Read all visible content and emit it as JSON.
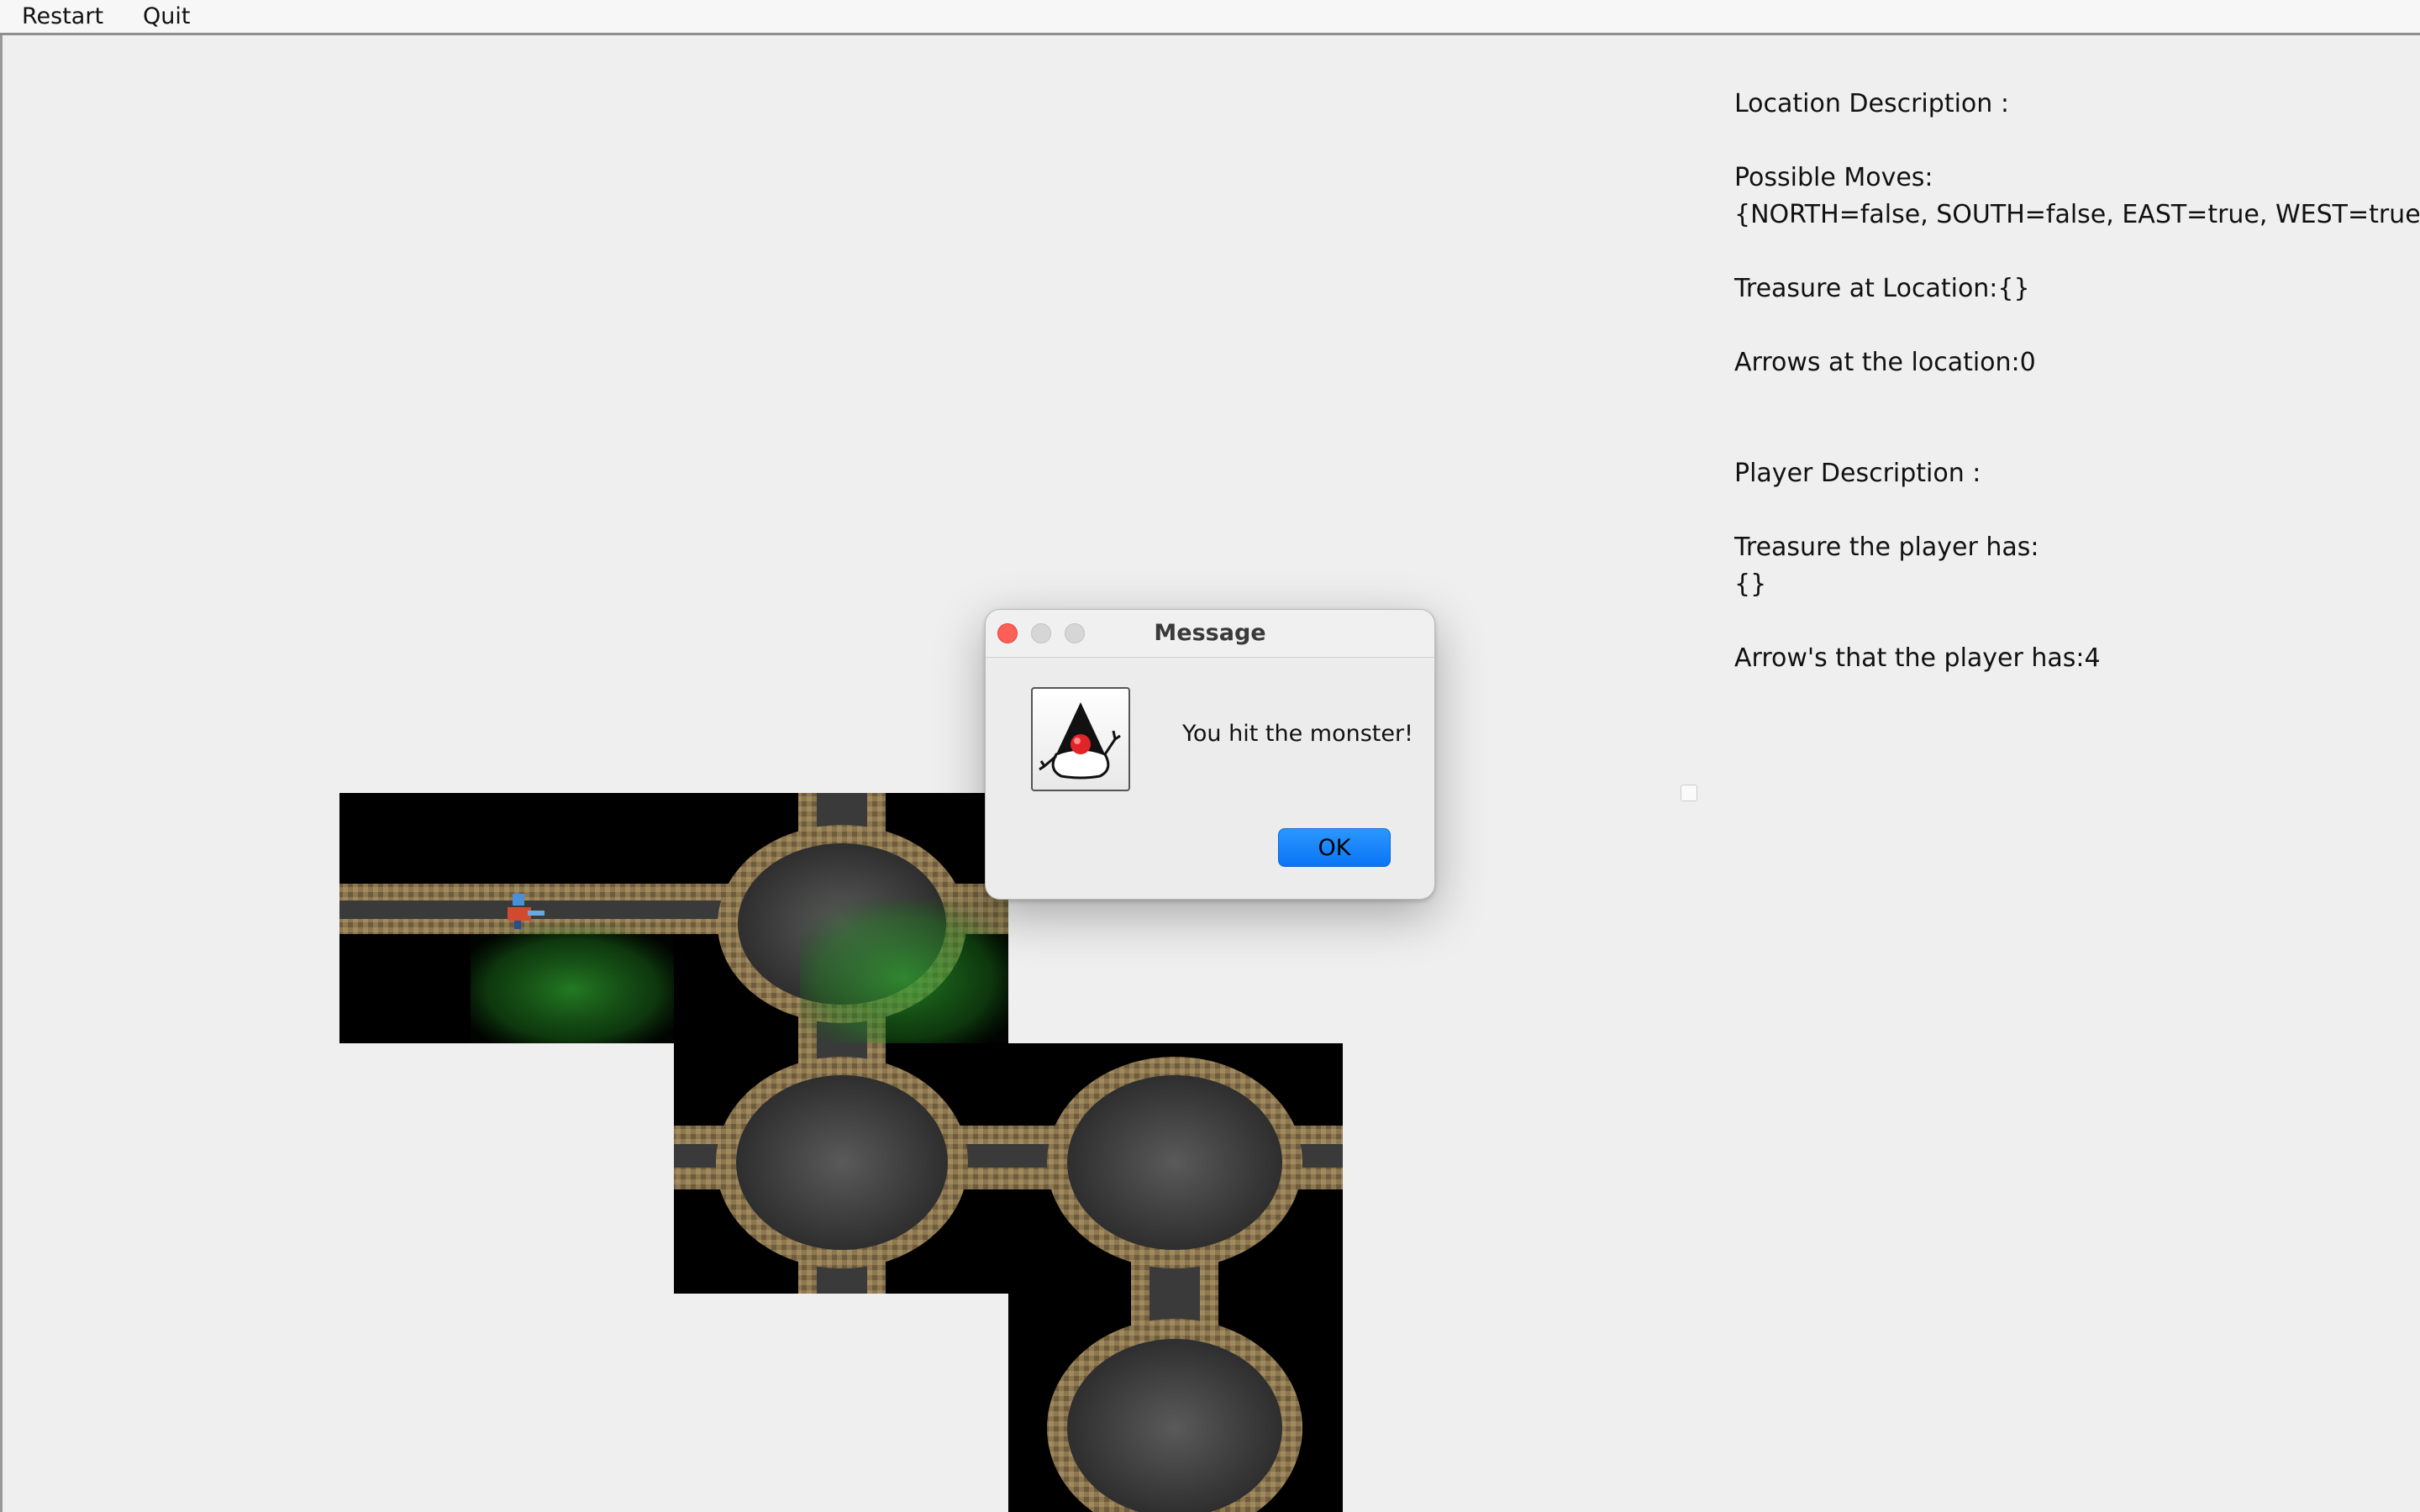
{
  "menu": {
    "restart_label": "Restart",
    "quit_label": "Quit"
  },
  "location": {
    "heading": "Location Description :",
    "moves_label": "Possible Moves:",
    "moves_value": "{NORTH=false, SOUTH=false, EAST=true, WEST=true}",
    "treasure_label": "Treasure at Location:{}",
    "arrows_label": "Arrows at the location:0"
  },
  "player": {
    "heading": "Player Description :",
    "treasure_label": "Treasure the player has:",
    "treasure_value": "{}",
    "arrows_label": "Arrow's that the player has:4"
  },
  "dialog": {
    "title": "Message",
    "message": "You hit the monster!",
    "ok_label": "OK",
    "icon": "java-duke-icon"
  },
  "map": {
    "tiles": [
      "corridor-east-west",
      "junction-east-west-south",
      "junction-north-south-east-west",
      "junction-west-south",
      "junction-north-only"
    ],
    "player_icon": "player-sprite",
    "smell_indicator": "green-stench-overlay"
  },
  "colors": {
    "background": "#efefef",
    "ok_button": "#0a7cff",
    "close_button": "#ff5f57",
    "stench": "#2fa22f"
  }
}
